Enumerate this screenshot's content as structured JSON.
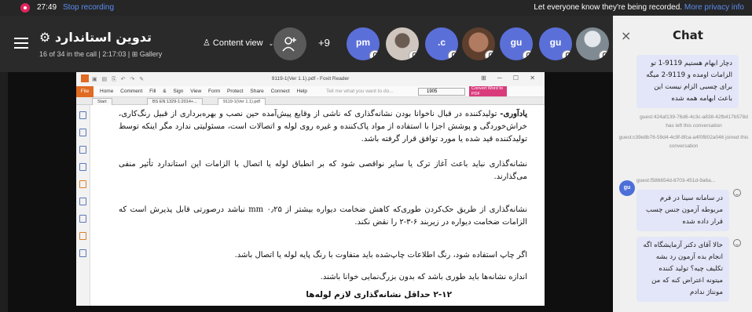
{
  "recording_bar": {
    "time": "27:49",
    "stop_label": "Stop recording",
    "notice": "Let everyone know they're being recorded.",
    "privacy_link": "More privacy info"
  },
  "meeting": {
    "title": "⚙ تدوین استاندارد",
    "subtitle": "16 of 34 in the call | 2:17:03 | ⊞ Gallery",
    "content_view_label": "Content view",
    "more_participants": "+9",
    "participants": [
      {
        "initials": "pm",
        "color": "#5b6fd9"
      },
      {
        "initials": "",
        "color": "#8a8a8a"
      },
      {
        "initials": ".c",
        "color": "#5b6fd9"
      },
      {
        "initials": "",
        "color": "#b07b60"
      },
      {
        "initials": "gu",
        "color": "#5b6fd9"
      },
      {
        "initials": "gu",
        "color": "#5b6fd9"
      },
      {
        "initials": "",
        "color": "#9aa0a8"
      }
    ]
  },
  "shared_doc": {
    "app_title": "9119-1(Ver 1.1).pdf - Foxit Reader",
    "menu": [
      "File",
      "Home",
      "Comment",
      "Fill & Sign",
      "View",
      "Form",
      "Protect",
      "Share",
      "Connect",
      "Help"
    ],
    "tell_me": "Tell me what you want to do...",
    "search_value": "1905",
    "convert_label": "Convert Word to PDF",
    "tabs": [
      "Start",
      "BS EN 1329-1:2014+...",
      "9119-1(Ver 1.1).pdf"
    ],
    "paragraphs": [
      {
        "lead": "یادآوری-",
        "text": " تولیدکننده در قبال ناخوانا بودن نشانه‌گذاری که ناشی از وقایع پیش‌آمده حین نصب و بهره‌برداری از قبیل رنگ‌کاری، خراش‌خوردگی و پوشش اجزا با استفاده از مواد پاک‌کننده و غیره روی لوله و اتصالات است، مسئولیتی ندارد مگر اینکه توسط تولیدکننده قید شده یا مورد توافق قرار گرفته باشد."
      },
      {
        "lead": "",
        "text": "نشانه‌گذاری نباید باعث آغاز ترک یا سایر نواقصی شود که بر انطباق لوله یا اتصال با الزامات این استاندارد تأثیر منفی می‌گذارند."
      },
      {
        "lead": "",
        "text": "نشانه‌گذاری از طریق حک‌کردن طوری‌که کاهش ضخامت دیواره بیشتر از ۰٫۲۵ mm نباشد درصورتی قابل پذیرش است که الزامات ضخامت دیواره در زیربند ۶-۳-۲ را نقض نکند."
      },
      {
        "lead": "",
        "text": "اگر چاپ استفاده شود، رنگ اطلاعات چاپ‌شده باید متفاوت با رنگ پایه لوله یا اتصال باشد."
      },
      {
        "lead": "",
        "text": "اندازه نشانه‌ها باید طوری باشد که بدون بزرگ‌نمایی خوانا باشند."
      }
    ],
    "heading": "۲-۱۲   حداقل نشانه‌گذاری لازم لوله‌ها"
  },
  "chat": {
    "title": "Chat",
    "close_label": "×",
    "msg1": "دچار ابهام هستیم 9119-1 تو الزامات اومده و 9119-2 میگه برای چسبی الزام نیست این باعث ابهامه همه شده",
    "sys1": "guest:424af139-76d6-4c3c-a838-42fb417b578d has left this conversation",
    "sys2": "guest:c39e8b76-59d4-4c9f-8fca-a4f0f802a046 joined this conversation",
    "sender_initials": "gu",
    "sender_name": "guest:f586654d-8703-451d-9a6a...",
    "msg2": "در سامانه سینا در فرم مربوطه آزمون جنس چسب قرار داده شده",
    "msg3": "حالا آقای دکتر آزمایشگاه اگه انجام بده آزمون رد بشه تکلیف چیه؟ تولید کننده میتونه اعتراض کنه که من مونتاژ ندادم"
  }
}
